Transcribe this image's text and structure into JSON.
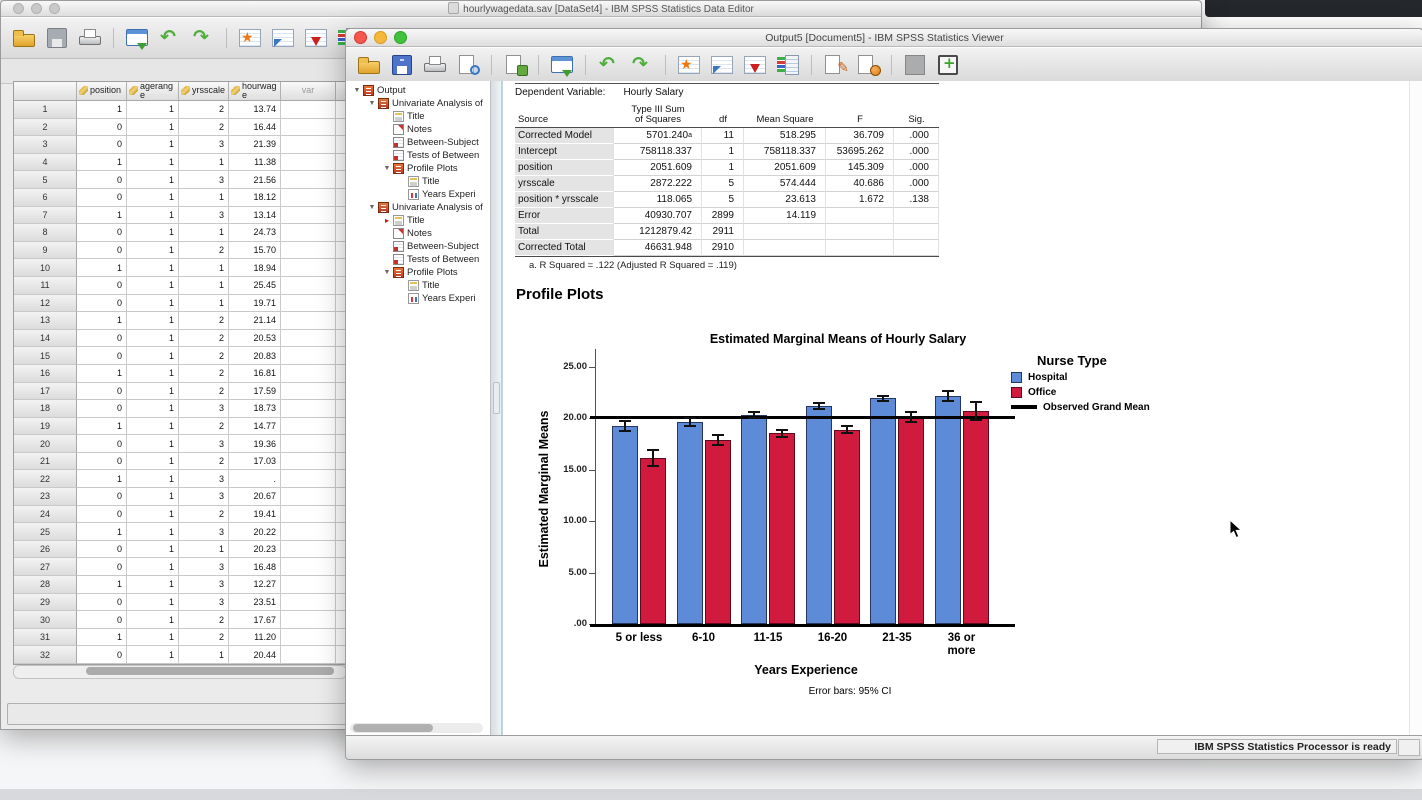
{
  "data_editor": {
    "title": "hourlywagedata.sav [DataSet4] - IBM SPSS Statistics Data Editor",
    "toolbar_icons": [
      "open",
      "save-gray",
      "print",
      "|",
      "recall",
      "undo",
      "redo",
      "|",
      "star",
      "gotovar",
      "insert",
      "varlist",
      "|",
      "graybox",
      "grid",
      "grid",
      "|",
      "edit",
      "refresh",
      "|",
      "fonta",
      "grid",
      "~",
      "grid",
      "grid",
      "grid",
      "grid"
    ],
    "grid": {
      "columns": [
        "position",
        "agerang\ne",
        "yrsscale",
        "hourwag\ne",
        "var"
      ],
      "rows": [
        [
          "1",
          "1",
          "2",
          "13.74"
        ],
        [
          "0",
          "1",
          "2",
          "16.44"
        ],
        [
          "0",
          "1",
          "3",
          "21.39"
        ],
        [
          "1",
          "1",
          "1",
          "11.38"
        ],
        [
          "0",
          "1",
          "3",
          "21.56"
        ],
        [
          "0",
          "1",
          "1",
          "18.12"
        ],
        [
          "1",
          "1",
          "3",
          "13.14"
        ],
        [
          "0",
          "1",
          "1",
          "24.73"
        ],
        [
          "0",
          "1",
          "2",
          "15.70"
        ],
        [
          "1",
          "1",
          "1",
          "18.94"
        ],
        [
          "0",
          "1",
          "1",
          "25.45"
        ],
        [
          "0",
          "1",
          "1",
          "19.71"
        ],
        [
          "1",
          "1",
          "2",
          "21.14"
        ],
        [
          "0",
          "1",
          "2",
          "20.53"
        ],
        [
          "0",
          "1",
          "2",
          "20.83"
        ],
        [
          "1",
          "1",
          "2",
          "16.81"
        ],
        [
          "0",
          "1",
          "2",
          "17.59"
        ],
        [
          "0",
          "1",
          "3",
          "18.73"
        ],
        [
          "1",
          "1",
          "2",
          "14.77"
        ],
        [
          "0",
          "1",
          "3",
          "19.36"
        ],
        [
          "0",
          "1",
          "2",
          "17.03"
        ],
        [
          "1",
          "1",
          "3",
          "."
        ],
        [
          "0",
          "1",
          "3",
          "20.67"
        ],
        [
          "0",
          "1",
          "2",
          "19.41"
        ],
        [
          "1",
          "1",
          "3",
          "20.22"
        ],
        [
          "0",
          "1",
          "1",
          "20.23"
        ],
        [
          "0",
          "1",
          "3",
          "16.48"
        ],
        [
          "1",
          "1",
          "3",
          "12.27"
        ],
        [
          "0",
          "1",
          "3",
          "23.51"
        ],
        [
          "0",
          "1",
          "2",
          "17.67"
        ],
        [
          "1",
          "1",
          "2",
          "11.20"
        ],
        [
          "0",
          "1",
          "1",
          "20.44"
        ]
      ]
    }
  },
  "viewer": {
    "title": "Output5 [Document5] - IBM SPSS Statistics Viewer",
    "toolbar_icons": [
      "open",
      "save-blue",
      "print",
      "preview",
      "|",
      "export",
      "|",
      "recall",
      "|",
      "undo",
      "redo",
      "|",
      "star",
      "gotovar",
      "insert",
      "varlist",
      "|",
      "edit",
      "refresh",
      "|",
      "graybox",
      "plusbox"
    ],
    "outline": [
      {
        "label": "Output",
        "depth": 0,
        "expander": true,
        "icon": "book"
      },
      {
        "label": "Univariate Analysis of",
        "depth": 1,
        "expander": true,
        "icon": "book"
      },
      {
        "label": "Title",
        "depth": 2,
        "icon": "title"
      },
      {
        "label": "Notes",
        "depth": 2,
        "icon": "notes"
      },
      {
        "label": "Between-Subject",
        "depth": 2,
        "icon": "table"
      },
      {
        "label": "Tests of Between",
        "depth": 2,
        "icon": "table"
      },
      {
        "label": "Profile Plots",
        "depth": 2,
        "expander": true,
        "icon": "book"
      },
      {
        "label": "Title",
        "depth": 3,
        "icon": "title"
      },
      {
        "label": "Years Experi",
        "depth": 3,
        "icon": "chart"
      },
      {
        "label": "Univariate Analysis of",
        "depth": 1,
        "expander": true,
        "icon": "book"
      },
      {
        "label": "Title",
        "depth": 2,
        "icon": "title",
        "selected": true
      },
      {
        "label": "Notes",
        "depth": 2,
        "icon": "notes"
      },
      {
        "label": "Between-Subject",
        "depth": 2,
        "icon": "table"
      },
      {
        "label": "Tests of Between",
        "depth": 2,
        "icon": "table"
      },
      {
        "label": "Profile Plots",
        "depth": 2,
        "expander": true,
        "icon": "book"
      },
      {
        "label": "Title",
        "depth": 3,
        "icon": "title"
      },
      {
        "label": "Years Experi",
        "depth": 3,
        "icon": "chart"
      }
    ],
    "anova": {
      "dependent_label": "Dependent Variable:",
      "dependent_value": "Hourly Salary",
      "headers": [
        "Source",
        "Type III Sum\nof Squares",
        "df",
        "Mean Square",
        "F",
        "Sig."
      ],
      "rows": [
        [
          "Corrected Model",
          "5701.240^a",
          "11",
          "518.295",
          "36.709",
          ".000"
        ],
        [
          "Intercept",
          "758118.337",
          "1",
          "758118.337",
          "53695.262",
          ".000"
        ],
        [
          "position",
          "2051.609",
          "1",
          "2051.609",
          "145.309",
          ".000"
        ],
        [
          "yrsscale",
          "2872.222",
          "5",
          "574.444",
          "40.686",
          ".000"
        ],
        [
          "position * yrsscale",
          "118.065",
          "5",
          "23.613",
          "1.672",
          ".138"
        ],
        [
          "Error",
          "40930.707",
          "2899",
          "14.119",
          "",
          ""
        ],
        [
          "Total",
          "1212879.42",
          "2911",
          "",
          "",
          ""
        ],
        [
          "Corrected Total",
          "46631.948",
          "2910",
          "",
          "",
          ""
        ]
      ],
      "footnote": "a. R Squared = .122 (Adjusted R Squared = .119)"
    },
    "section_heading": "Profile Plots",
    "status": "IBM SPSS Statistics Processor is ready"
  },
  "chart_data": {
    "type": "bar",
    "title": "Estimated Marginal Means of Hourly Salary",
    "xlabel": "Years Experience",
    "ylabel": "Estimated Marginal Means",
    "footnote": "Error bars: 95% CI",
    "categories": [
      "5 or less",
      "6-10",
      "11-15",
      "16-20",
      "21-35",
      "36 or\nmore"
    ],
    "ytick_values": [
      25,
      20,
      15,
      10,
      5,
      0
    ],
    "ytick_labels": [
      "25.00",
      "20.00",
      "15.00",
      "10.00",
      "5.00",
      ".00"
    ],
    "ylim": [
      0,
      26.5
    ],
    "legend_title": "Nurse Type",
    "legend_position": "right",
    "series": [
      {
        "name": "Hospital",
        "color": "#5e8bd8",
        "border": "#26365e",
        "values": [
          19.2,
          19.6,
          20.3,
          21.2,
          21.9,
          22.15
        ],
        "errors": [
          0.6,
          0.45,
          0.35,
          0.4,
          0.35,
          0.6
        ]
      },
      {
        "name": "Office",
        "color": "#d01a3e",
        "border": "#5e0a1e",
        "values": [
          16.1,
          17.85,
          18.5,
          18.85,
          20.1,
          20.7
        ],
        "errors": [
          0.85,
          0.6,
          0.45,
          0.45,
          0.6,
          0.95
        ]
      }
    ],
    "grand_mean": {
      "label": "Observed Grand Mean",
      "value": 20.1
    },
    "error_bars": "95% CI"
  }
}
